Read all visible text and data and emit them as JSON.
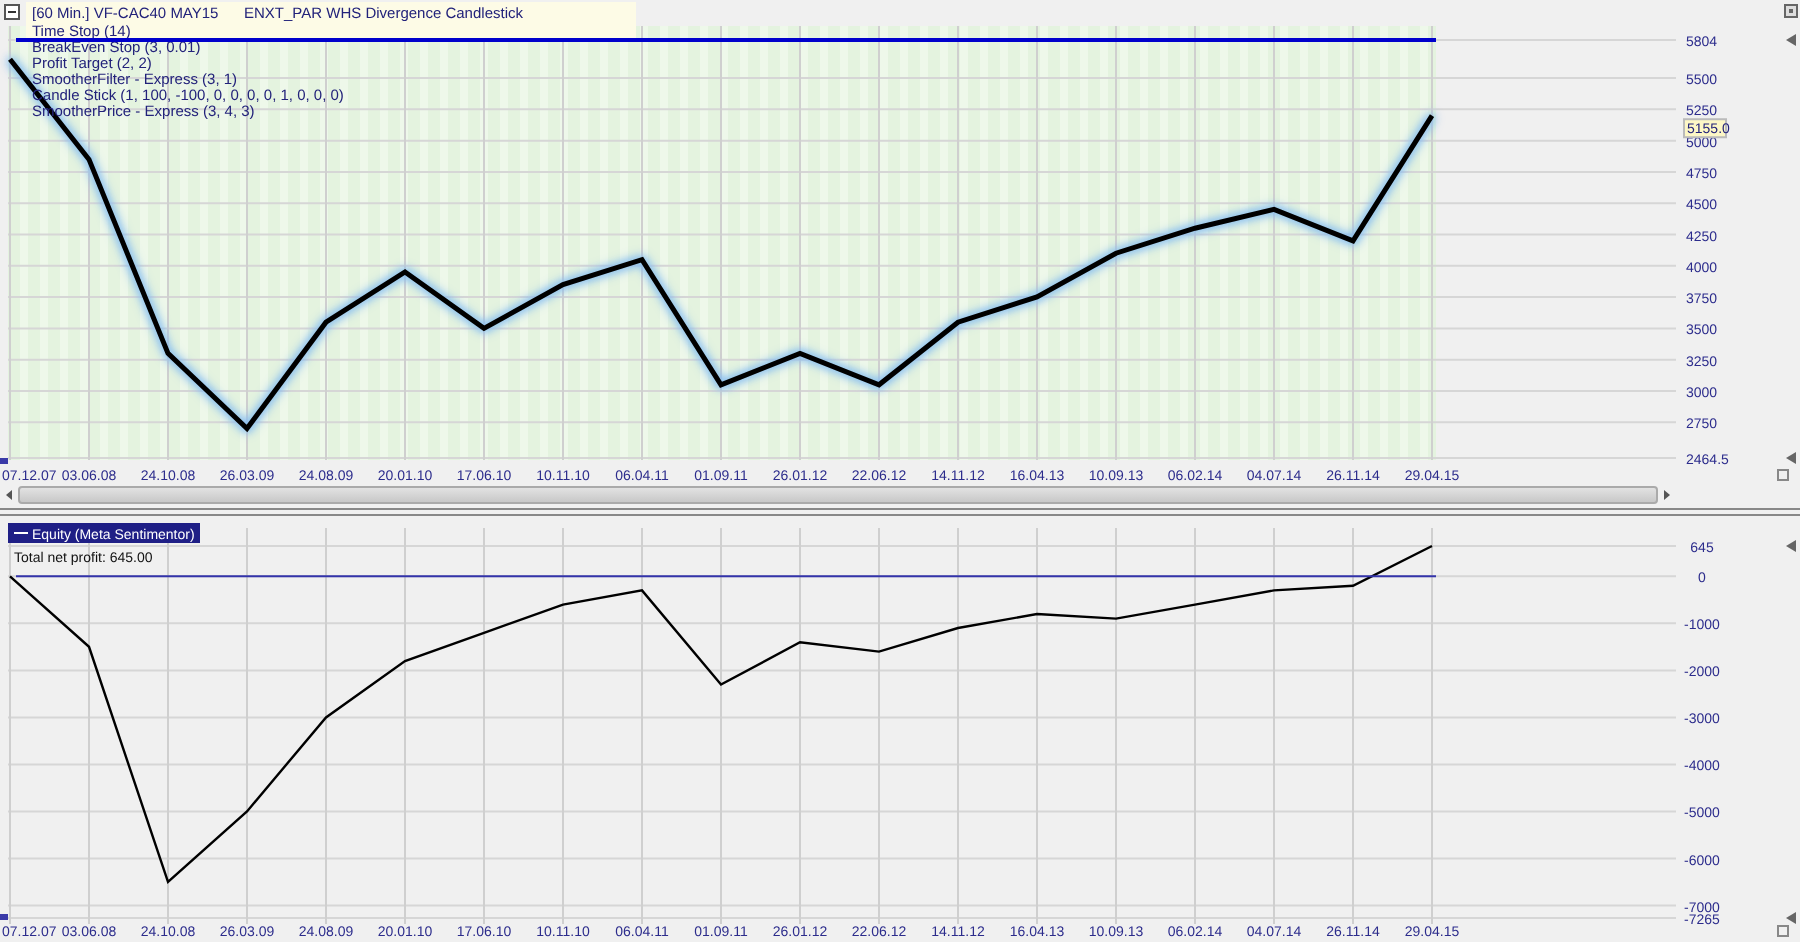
{
  "price_pane": {
    "kind": "price",
    "header": {
      "interval": "[60 Min.]",
      "subtitle": "ENXT_PAR WHS Divergence Candlestick"
    },
    "indicators": [
      "Time Stop  (14)",
      "BreakEven Stop  (3, 0.01)",
      "Profit Target  (2, 2)",
      "SmootherFilter - Express  (3, 1)",
      "Candle Stick  (1, 100, -100, 0, 0, 0, 0, 1, 0, 0, 0)",
      "SmootherPrice - Express  (3, 4, 3)"
    ],
    "last_price": "5155.0",
    "chart_data": {
      "type": "line",
      "x": [
        "07.12.07",
        "03.06.08",
        "24.10.08",
        "26.03.09",
        "24.08.09",
        "20.01.10",
        "17.06.10",
        "10.11.10",
        "06.04.11",
        "01.09.11",
        "26.01.12",
        "22.06.12",
        "14.11.12",
        "16.04.13",
        "10.09.13",
        "06.02.14",
        "04.07.14",
        "26.11.14",
        "29.04.15"
      ],
      "series": [
        {
          "name": "VF-CAC40 MAY15",
          "color": "#000000",
          "values": [
            5650,
            4850,
            3300,
            2700,
            3550,
            3950,
            3500,
            3850,
            4050,
            3050,
            3300,
            3050,
            3550,
            3750,
            4100,
            4300,
            4450,
            4200,
            5200
          ]
        }
      ],
      "ylim": [
        2464.5,
        5804
      ],
      "grid": true,
      "yticks": [
        {
          "value": 5804,
          "label": "5804"
        },
        {
          "value": 5500,
          "label": "5500"
        },
        {
          "value": 5250,
          "label": "5250"
        },
        {
          "value": 5000,
          "label": "5000"
        },
        {
          "value": 4750,
          "label": "4750"
        },
        {
          "value": 4500,
          "label": "4500"
        },
        {
          "value": 4250,
          "label": "4250"
        },
        {
          "value": 4000,
          "label": "4000"
        },
        {
          "value": 3750,
          "label": "3750"
        },
        {
          "value": 3500,
          "label": "3500"
        },
        {
          "value": 3250,
          "label": "3250"
        },
        {
          "value": 3000,
          "label": "3000"
        },
        {
          "value": 2750,
          "label": "2750"
        },
        {
          "value": 2464.5,
          "label": "2464.5"
        }
      ]
    }
  },
  "equity_pane": {
    "kind": "equity",
    "total_net_profit": "Total net profit: 645.00",
    "chart_data": {
      "type": "line",
      "x": [
        "07.12.07",
        "03.06.08",
        "24.10.08",
        "26.03.09",
        "24.08.09",
        "20.01.10",
        "17.06.10",
        "10.11.10",
        "06.04.11",
        "01.09.11",
        "26.01.12",
        "22.06.12",
        "14.11.12",
        "16.04.13",
        "10.09.13",
        "06.02.14",
        "04.07.14",
        "26.11.14",
        "29.04.15"
      ],
      "series": [
        {
          "name": "Equity (Meta Sentimentor)",
          "color": "#000000",
          "values": [
            0,
            -1500,
            -6500,
            -5000,
            -3000,
            -1800,
            -1200,
            -600,
            -300,
            -2300,
            -1400,
            -1600,
            -1100,
            -800,
            -900,
            -600,
            -300,
            -200,
            645
          ]
        }
      ],
      "ylim": [
        -7265,
        645
      ],
      "grid": true,
      "yticks": [
        {
          "value": 645,
          "label": "645"
        },
        {
          "value": 0,
          "label": "0"
        },
        {
          "value": -1000,
          "label": "-1000"
        },
        {
          "value": -2000,
          "label": "-2000"
        },
        {
          "value": -3000,
          "label": "-3000"
        },
        {
          "value": -4000,
          "label": "-4000"
        },
        {
          "value": -5000,
          "label": "-5000"
        },
        {
          "value": -6000,
          "label": "-6000"
        },
        {
          "value": -7000,
          "label": "-7000"
        },
        {
          "value": -7265,
          "label": "-7265"
        }
      ]
    }
  }
}
